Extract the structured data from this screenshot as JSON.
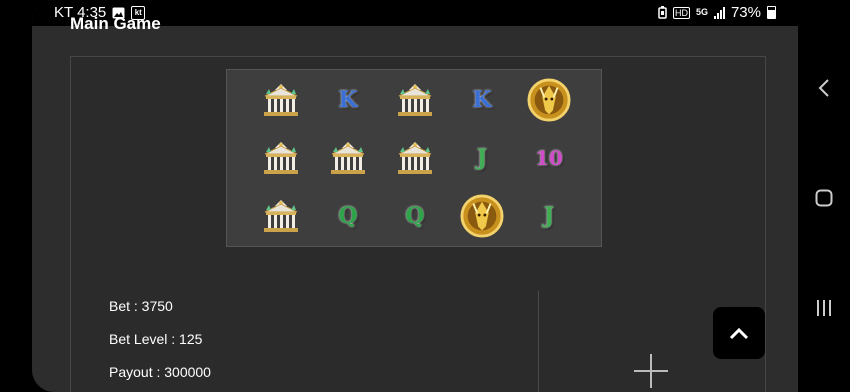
{
  "status_bar": {
    "carrier_time": "KT 4:35",
    "kt_badge": "kt",
    "hd_label": "HD",
    "network": "5G",
    "battery_text": "73%"
  },
  "main": {
    "section_title": "Main Game",
    "reels": [
      [
        "temple",
        "K",
        "temple",
        "K",
        "warrior-coin"
      ],
      [
        "temple",
        "temple",
        "temple",
        "J",
        "10"
      ],
      [
        "temple",
        "Q",
        "Q",
        "warrior-coin",
        "J"
      ]
    ],
    "bet_text": "Bet : 3750",
    "bet_level_text": "Bet Level : 125",
    "payout_text": "Payout : 300000"
  },
  "colors": {
    "page_bg": "#2d2d2d",
    "panel_bg": "#2b2b2b",
    "reel_bg": "#3e3e3e",
    "scroll_button_bg": "#000000"
  }
}
